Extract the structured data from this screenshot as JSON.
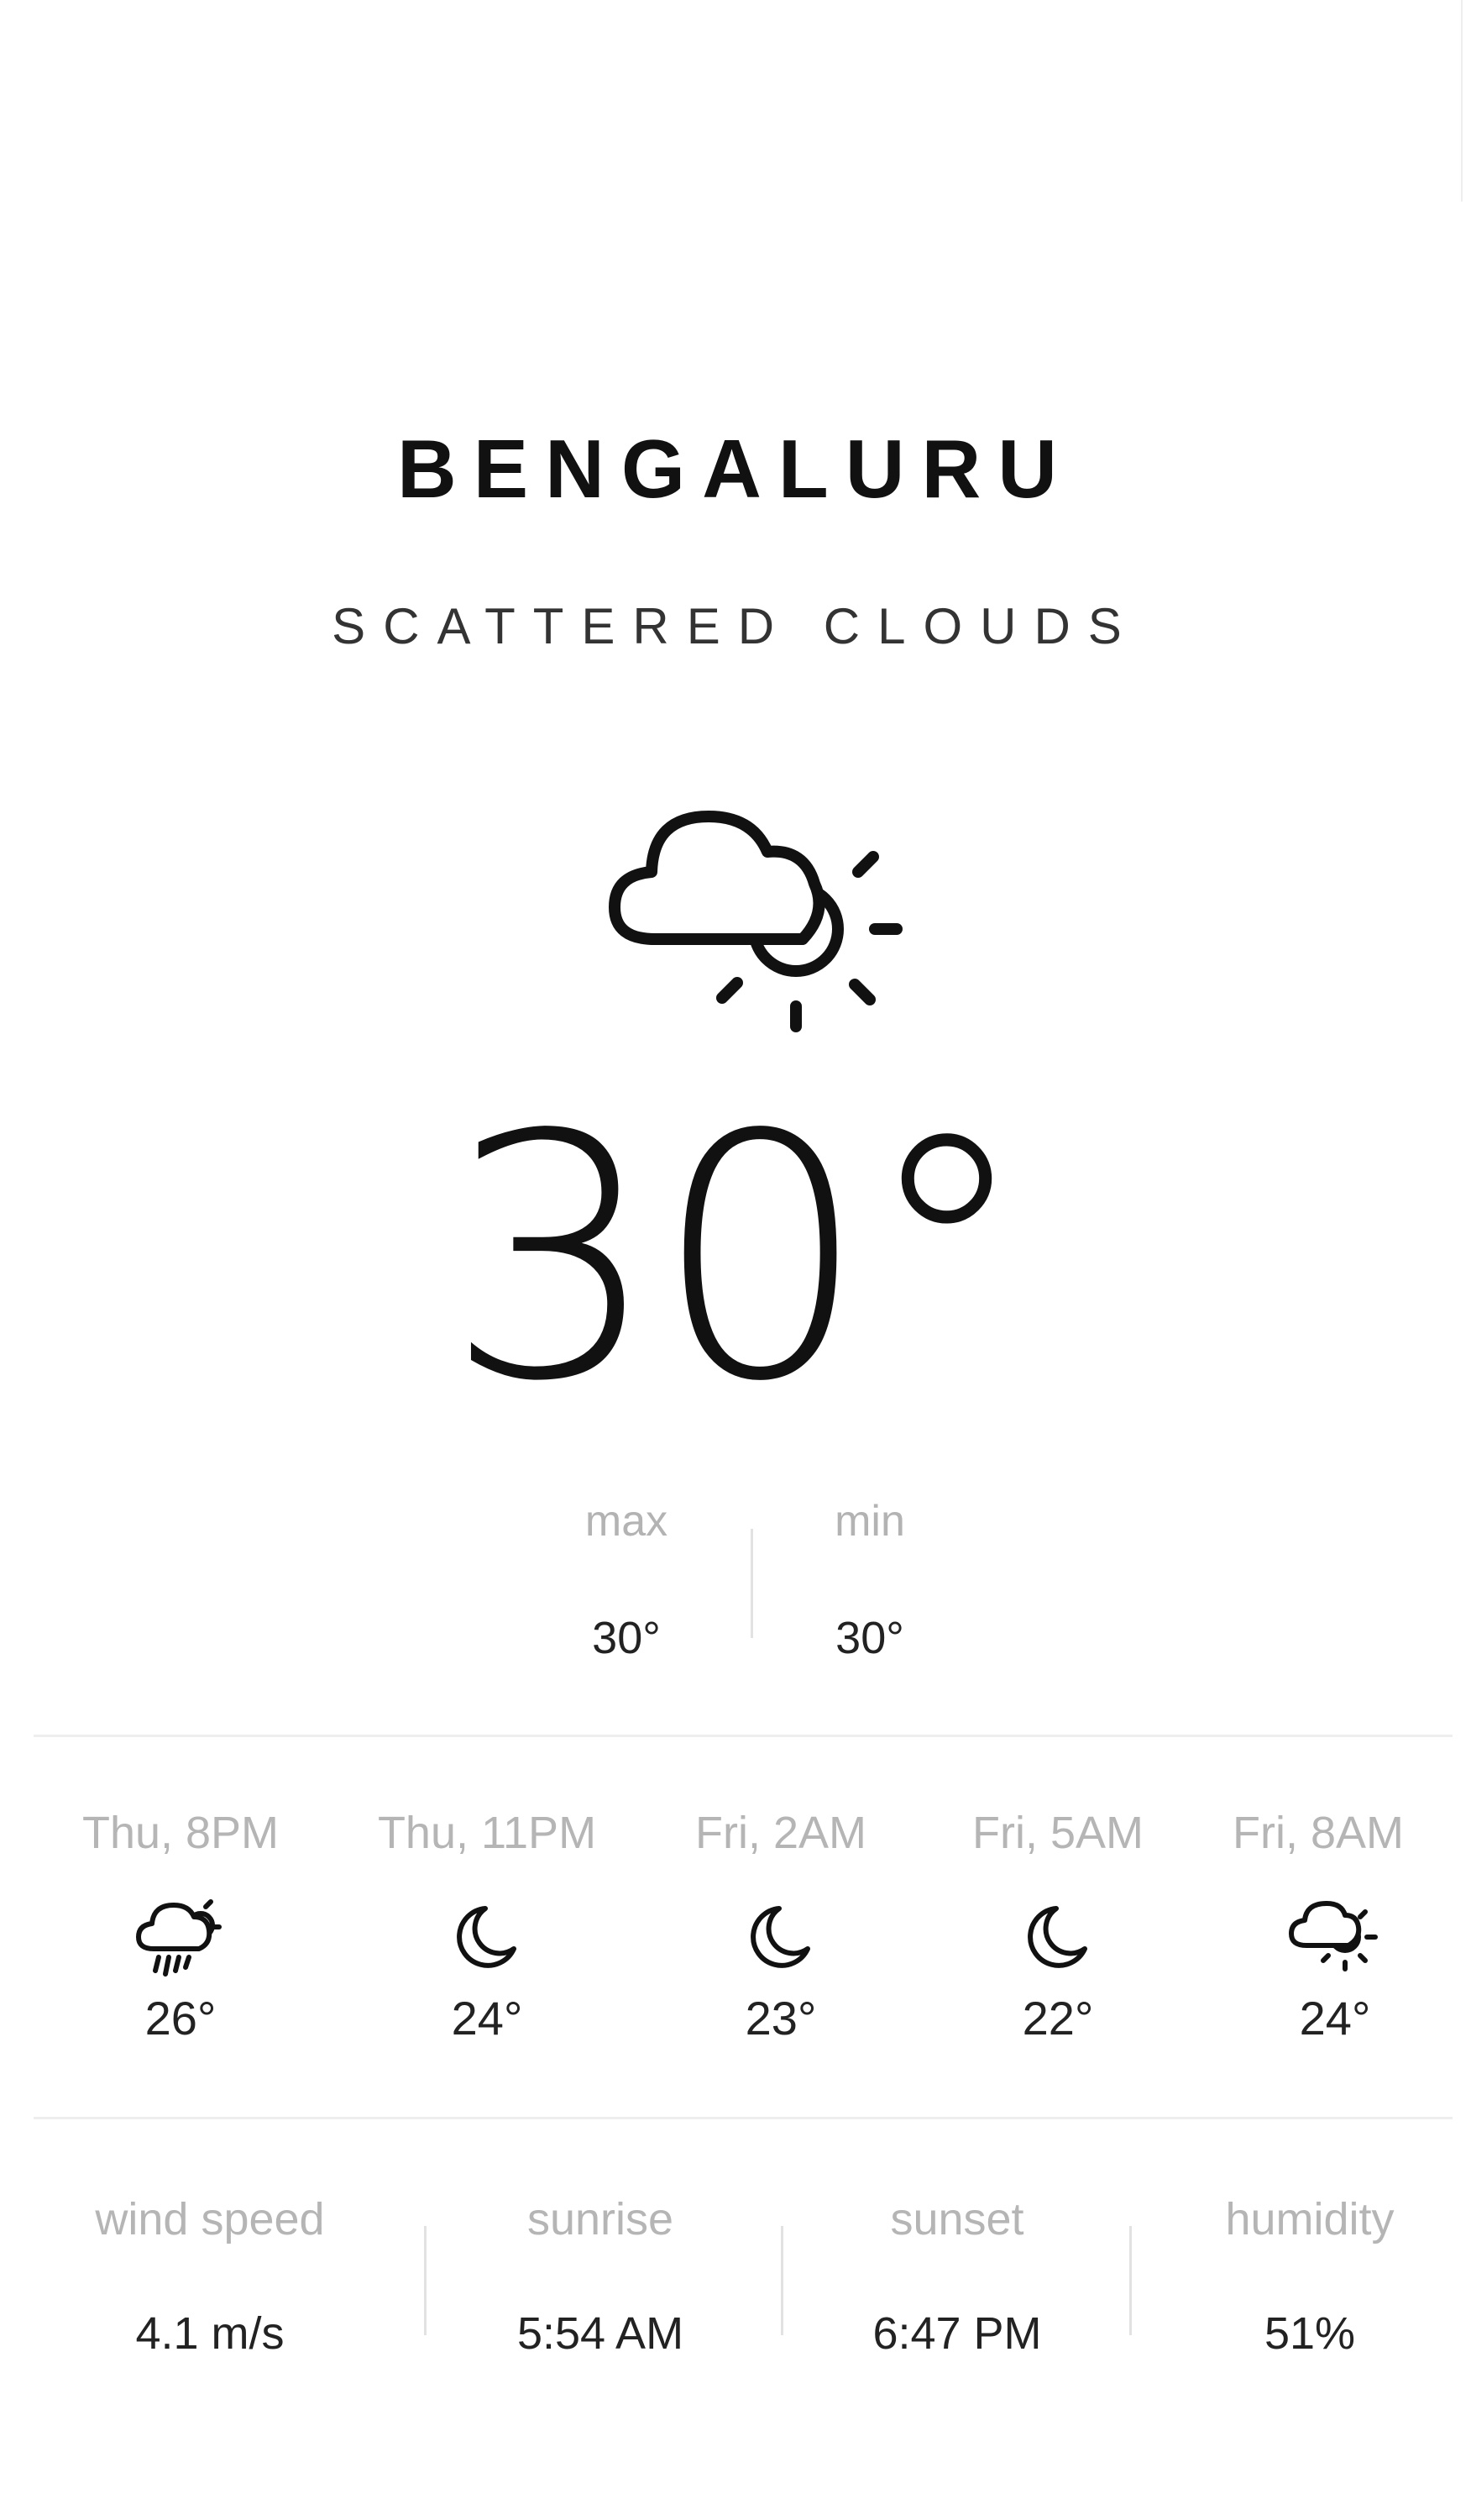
{
  "location": {
    "city": "BENGALURU",
    "description": "SCATTERED CLOUDS"
  },
  "current": {
    "icon": "partly-cloudy-sun-icon",
    "temperature": "30°",
    "max_label": "max",
    "max_value": "30°",
    "min_label": "min",
    "min_value": "30°"
  },
  "forecast": [
    {
      "time": "Thu, 8PM",
      "icon": "rain-cloud-icon",
      "temp": "26°"
    },
    {
      "time": "Thu, 11PM",
      "icon": "moon-icon",
      "temp": "24°"
    },
    {
      "time": "Fri, 2AM",
      "icon": "moon-icon",
      "temp": "23°"
    },
    {
      "time": "Fri, 5AM",
      "icon": "moon-icon",
      "temp": "22°"
    },
    {
      "time": "Fri, 8AM",
      "icon": "partly-cloudy-sun-icon",
      "temp": "24°"
    }
  ],
  "stats": [
    {
      "label": "wind speed",
      "value": "4.1 m/s"
    },
    {
      "label": "sunrise",
      "value": "5:54 AM"
    },
    {
      "label": "sunset",
      "value": "6:47 PM"
    },
    {
      "label": "humidity",
      "value": "51%"
    }
  ]
}
